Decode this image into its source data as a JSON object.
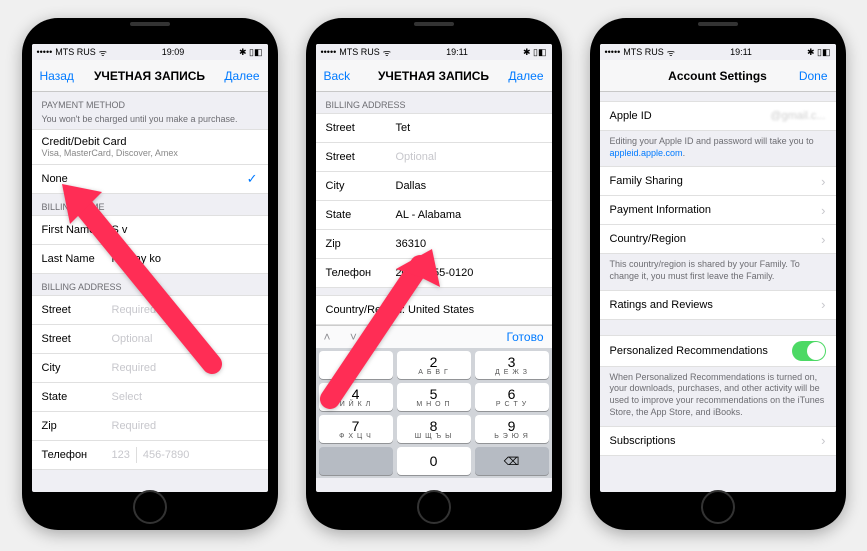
{
  "status": {
    "carrier": "MTS RUS"
  },
  "phone1": {
    "time": "19:09",
    "nav": {
      "back": "Назад",
      "title": "УЧЕТНАЯ ЗАПИСЬ",
      "next": "Далее"
    },
    "payment": {
      "header": "PAYMENT METHOD",
      "sub": "You won't be charged until you make a purchase.",
      "cc": "Credit/Debit Card",
      "cc_sub": "Visa, MasterCard, Discover, Amex",
      "none": "None"
    },
    "name": {
      "header": "BILLING NAME",
      "first_lbl": "First Name",
      "first_val": "S           v",
      "last_lbl": "Last Name",
      "last_val": "Mikhay   ko"
    },
    "addr": {
      "header": "BILLING ADDRESS",
      "street_lbl": "Street",
      "street_ph": "Required",
      "street2_lbl": "Street",
      "street2_ph": "Optional",
      "city_lbl": "City",
      "city_ph": "Required",
      "state_lbl": "State",
      "state_ph": "Select",
      "zip_lbl": "Zip",
      "zip_ph": "Required",
      "tel_lbl": "Телефон",
      "tel_code": "123",
      "tel_num": "456-7890"
    }
  },
  "phone2": {
    "time": "19:11",
    "nav": {
      "back": "Back",
      "title": "УЧЕТНАЯ ЗАПИСЬ",
      "next": "Далее"
    },
    "addr": {
      "header": "BILLING ADDRESS",
      "street_lbl": "Street",
      "street_val": "Tet",
      "street2_lbl": "Street",
      "street2_ph": "Optional",
      "city_lbl": "City",
      "city_val": "Dallas",
      "state_lbl": "State",
      "state_val": "AL - Alabama",
      "zip_lbl": "Zip",
      "zip_val": "36310",
      "tel_lbl": "Телефон",
      "tel_code": "202",
      "tel_num": "555-0120",
      "country": "Country/Region: United States"
    },
    "kb": {
      "done": "Готово",
      "k1": "1",
      "k2": "2",
      "k2l": "А Б В Г",
      "k3": "3",
      "k3l": "Д Е Ж З",
      "k4": "4",
      "k4l": "И Й К Л",
      "k5": "5",
      "k5l": "М Н О П",
      "k6": "6",
      "k6l": "Р С Т У",
      "k7": "7",
      "k7l": "Ф Х Ц Ч",
      "k8": "8",
      "k8l": "Ш Щ Ъ Ы",
      "k9": "9",
      "k9l": "Ь Э Ю Я",
      "k0": "0"
    }
  },
  "phone3": {
    "time": "19:11",
    "nav": {
      "title": "Account Settings",
      "done": "Done"
    },
    "appleid_lbl": "Apple ID",
    "appleid_val": "@gmail.c...",
    "appleid_foot1": "Editing your Apple ID and password will take you to ",
    "appleid_link": "appleid.apple.com",
    "fam": "Family Sharing",
    "pay": "Payment Information",
    "region": "Country/Region",
    "region_foot": "This country/region is shared by your Family. To change it, you must first leave the Family.",
    "ratings": "Ratings and Reviews",
    "pers": "Personalized Recommendations",
    "pers_foot": "When Personalized Recommendations is turned on, your downloads, purchases, and other activity will be used to improve your recommendations on the iTunes Store, the App Store, and iBooks.",
    "subs": "Subscriptions"
  }
}
